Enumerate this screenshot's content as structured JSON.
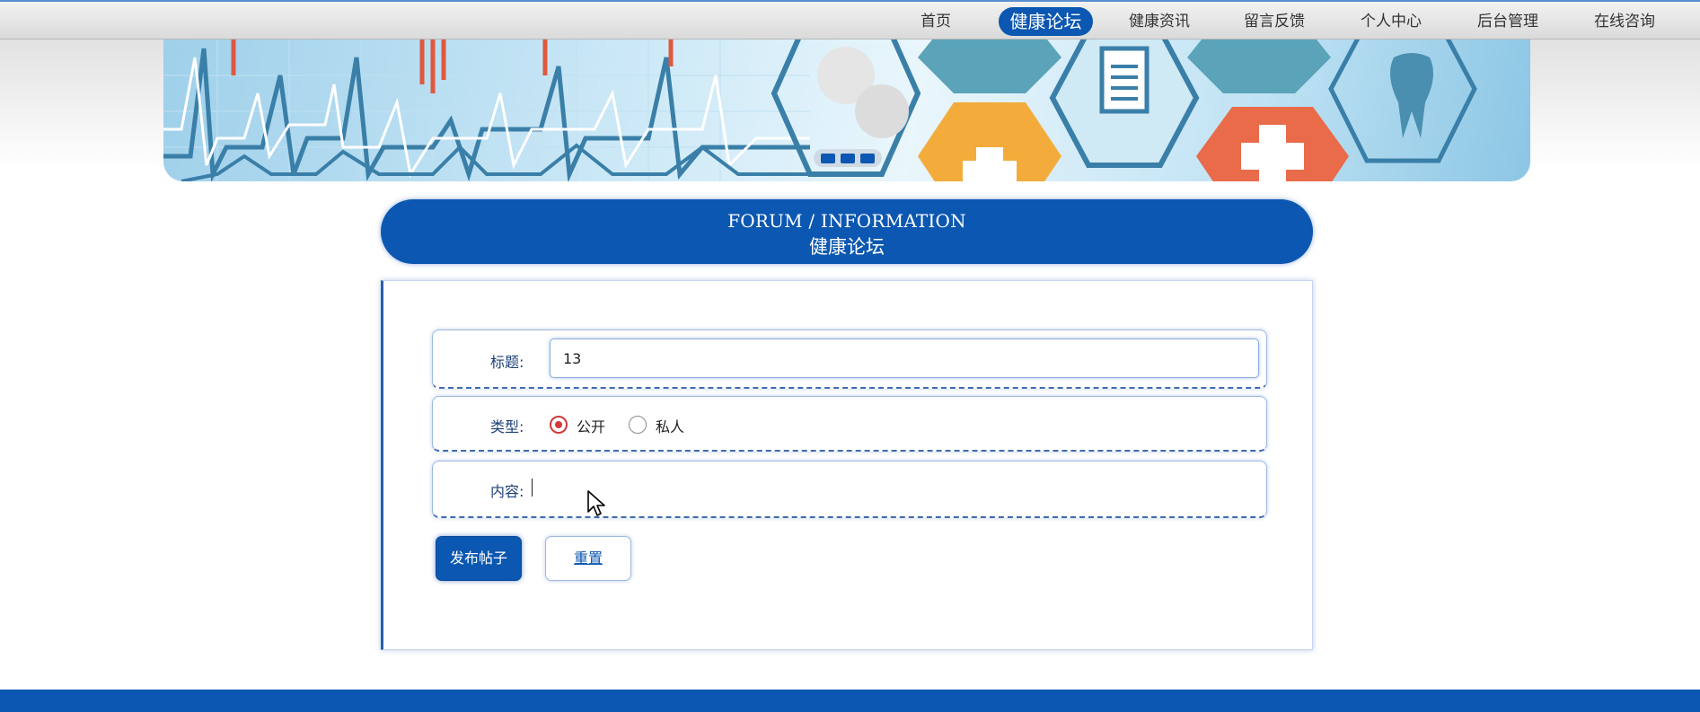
{
  "nav": {
    "items": [
      {
        "label": "首页",
        "active": false
      },
      {
        "label": "健康论坛",
        "active": true
      },
      {
        "label": "健康资讯",
        "active": false
      },
      {
        "label": "留言反馈",
        "active": false
      },
      {
        "label": "个人中心",
        "active": false
      },
      {
        "label": "后台管理",
        "active": false
      },
      {
        "label": "在线咨询",
        "active": false
      }
    ]
  },
  "section": {
    "title_en": "FORUM / INFORMATION",
    "title_cn": "健康论坛"
  },
  "form": {
    "title_label": "标题:",
    "title_value": "13",
    "type_label": "类型:",
    "type_options": [
      "公开",
      "私人"
    ],
    "type_selected": "公开",
    "content_label": "内容:",
    "content_value": "",
    "submit_label": "发布帖子",
    "reset_label": "重置"
  },
  "colors": {
    "primary": "#0b57b1",
    "radio_checked": "#d23a3a"
  }
}
